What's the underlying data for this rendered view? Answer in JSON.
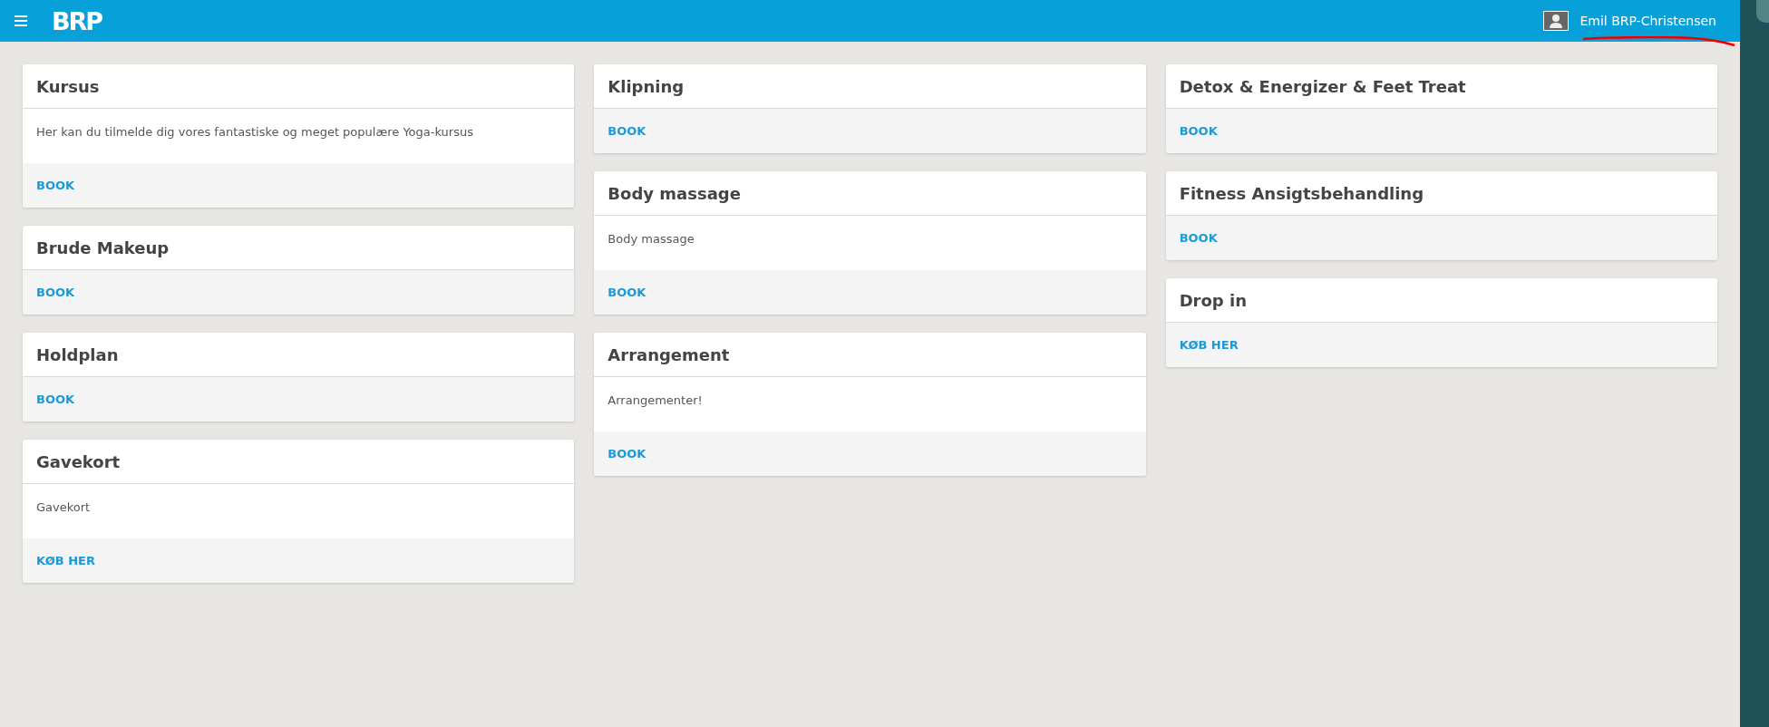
{
  "header": {
    "logo": "BRP",
    "user_name": "Emil BRP-Christensen"
  },
  "columns": [
    [
      {
        "title": "Kursus",
        "description": "Her kan du tilmelde dig vores fantastiske og meget populære Yoga-kursus",
        "action": "BOOK"
      },
      {
        "title": "Brude Makeup",
        "action": "BOOK"
      },
      {
        "title": "Holdplan",
        "action": "BOOK"
      },
      {
        "title": "Gavekort",
        "description": "Gavekort",
        "action": "KØB HER"
      }
    ],
    [
      {
        "title": "Klipning",
        "action": "BOOK"
      },
      {
        "title": "Body massage",
        "description": "Body massage",
        "action": "BOOK"
      },
      {
        "title": "Arrangement",
        "description": "Arrangementer!",
        "action": "BOOK"
      }
    ],
    [
      {
        "title": "Detox & Energizer & Feet Treat",
        "action": "BOOK"
      },
      {
        "title": "Fitness Ansigtsbehandling",
        "action": "BOOK"
      },
      {
        "title": "Drop in",
        "action": "KØB HER"
      }
    ]
  ]
}
